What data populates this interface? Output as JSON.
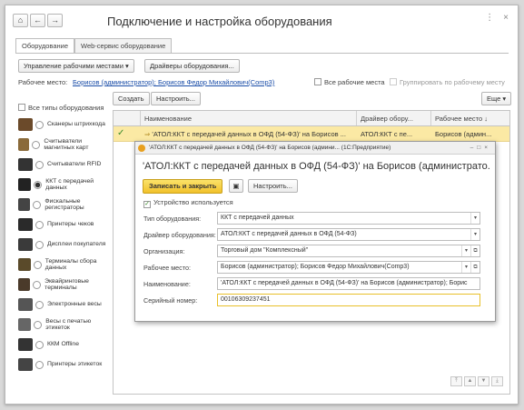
{
  "window": {
    "title": "Подключение и настройка оборудования"
  },
  "tabs": [
    {
      "label": "Оборудование"
    },
    {
      "label": "Web-сервис оборудование"
    }
  ],
  "toolbar": {
    "manage_places": "Управление рабочими местами",
    "drivers": "Драйверы оборудования..."
  },
  "workplace": {
    "label": "Рабочее место:",
    "value": "Борисов (администратор); Борисов Федор Михайлович(Comp3)",
    "all_places": "Все рабочие места",
    "group_by_place": "Группировать по рабочему месту"
  },
  "list_toolbar": {
    "create": "Создать",
    "configure": "Настроить...",
    "more": "Еще"
  },
  "sidebar": {
    "all_types": "Все типы оборудования",
    "items": [
      {
        "label": "Сканеры штрихкода",
        "icon": "barcode-scanner-icon",
        "selected": false
      },
      {
        "label": "Считыватели магнитных карт",
        "icon": "card-reader-icon",
        "selected": false
      },
      {
        "label": "Считыватели RFID",
        "icon": "rfid-reader-icon",
        "selected": false
      },
      {
        "label": "ККТ с передачей данных",
        "icon": "kkt-icon",
        "selected": true
      },
      {
        "label": "Фискальные регистраторы",
        "icon": "fiscal-register-icon",
        "selected": false
      },
      {
        "label": "Принтеры чеков",
        "icon": "receipt-printer-icon",
        "selected": false
      },
      {
        "label": "Дисплеи покупателя",
        "icon": "customer-display-icon",
        "selected": false
      },
      {
        "label": "Терминалы сбора данных",
        "icon": "data-terminal-icon",
        "selected": false
      },
      {
        "label": "Эквайринговые терминалы",
        "icon": "acquiring-terminal-icon",
        "selected": false
      },
      {
        "label": "Электронные весы",
        "icon": "scales-icon",
        "selected": false
      },
      {
        "label": "Весы с печатью этикеток",
        "icon": "label-scales-icon",
        "selected": false
      },
      {
        "label": "ККМ Offline",
        "icon": "kkm-offline-icon",
        "selected": false
      },
      {
        "label": "Принтеры этикеток",
        "icon": "label-printer-icon",
        "selected": false
      }
    ]
  },
  "table": {
    "headers": {
      "name": "Наименование",
      "driver": "Драйвер обору...",
      "place": "Рабочее место"
    },
    "rows": [
      {
        "name": "'АТОЛ:ККТ с передачей данных в ОФД (54-ФЗ)' на Борисов ...",
        "driver": "АТОЛ:ККТ с пе...",
        "place": "Борисов (админ..."
      }
    ]
  },
  "dialog": {
    "window_title": "'АТОЛ:ККТ с передачей данных в ОФД (54-ФЗ)' на Борисов (админи... (1С:Предприятие)",
    "header": "'АТОЛ:ККТ с передачей данных в ОФД (54-ФЗ)' на Борисов (администрато...",
    "save_close": "Записать и закрыть",
    "configure": "Настроить...",
    "device_used": "Устройство используется",
    "fields": {
      "type": {
        "label": "Тип оборудования:",
        "value": "ККТ с передачей данных"
      },
      "driver": {
        "label": "Драйвер оборудования:",
        "value": "АТОЛ:ККТ с передачей данных в ОФД (54-ФЗ)"
      },
      "org": {
        "label": "Организация:",
        "value": "Торговый дом \"Комплексный\""
      },
      "place": {
        "label": "Рабочее место:",
        "value": "Борисов (администратор); Борисов Федор Михайлович(Comp3)"
      },
      "name": {
        "label": "Наименование:",
        "value": "'АТОЛ:ККТ с передачей данных в ОФД (54-ФЗ)' на Борисов (администратор); Бориc"
      },
      "serial": {
        "label": "Серийный номер:",
        "value": "00106309237451"
      }
    }
  },
  "colors": {
    "accent_yellow": "#f1c12b",
    "selected_row": "#fbe9a4",
    "link": "#1a4da8"
  }
}
